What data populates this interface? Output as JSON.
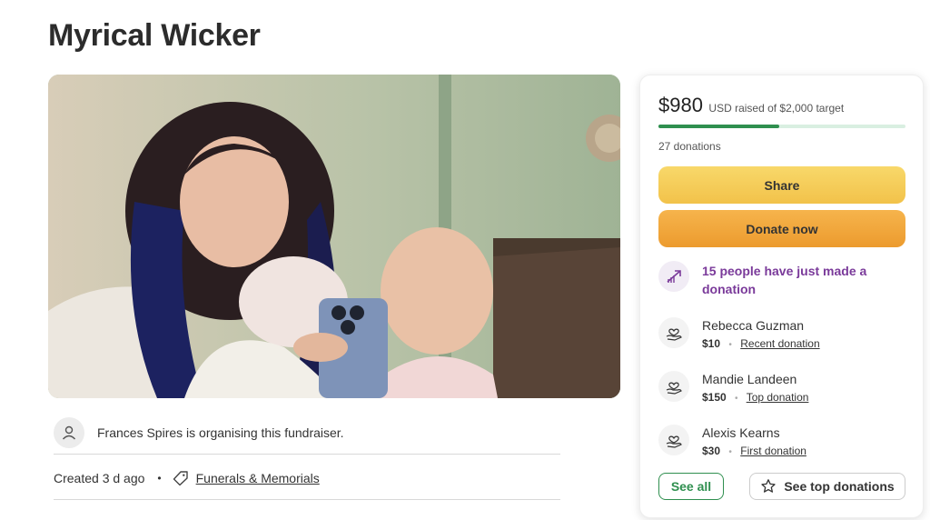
{
  "page": {
    "title": "Myrical Wicker"
  },
  "photo": {
    "description_icon": "campaign-photo"
  },
  "organiser": {
    "text": "Frances Spires is organising this fundraiser.",
    "icon": "person-icon"
  },
  "meta": {
    "created": "Created 3 d ago",
    "separator": "•",
    "category": "Funerals & Memorials",
    "category_icon": "tag-icon"
  },
  "donation_card": {
    "raised": "$980",
    "raised_sub": "USD raised of $2,000 target",
    "progress_fraction": 0.49,
    "donations_count": "27 donations",
    "share_label": "Share",
    "donate_label": "Donate now",
    "recent_activity": "15 people have just made a donation",
    "recent_icon": "trending-up-icon",
    "donors": [
      {
        "name": "Rebecca Guzman",
        "amount": "$10",
        "type": "Recent donation",
        "icon": "heart-hand-icon"
      },
      {
        "name": "Mandie Landeen",
        "amount": "$150",
        "type": "Top donation",
        "icon": "heart-hand-icon"
      },
      {
        "name": "Alexis Kearns",
        "amount": "$30",
        "type": "First donation",
        "icon": "heart-hand-icon"
      }
    ],
    "donor_separator": "•",
    "see_all_label": "See all",
    "see_top_label": "See top donations",
    "see_top_icon": "star-icon"
  },
  "colors": {
    "accent_green": "#2f8f4f",
    "share_yellow": "#f2c24a",
    "donate_orange": "#ec9b2e",
    "purple_text": "#7a3a9a"
  }
}
